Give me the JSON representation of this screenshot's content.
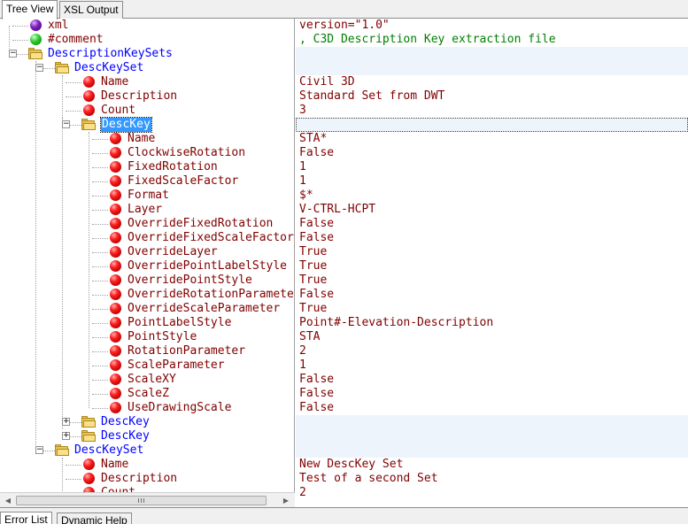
{
  "tabs": {
    "tree_view": "Tree View",
    "xsl_output": "XSL Output"
  },
  "bottom_tabs": {
    "error_list": "Error List",
    "dynamic_help": "Dynamic Help"
  },
  "tree": [
    {
      "label": "xml",
      "value": "version=\"1.0\"",
      "icon": "purple-ball",
      "expander": "none"
    },
    {
      "label": "#comment",
      "value": " , C3D Description Key extraction file",
      "icon": "green-ball",
      "expander": "none",
      "value_color": "green"
    },
    {
      "label": "DescriptionKeySets",
      "value": "",
      "icon": "folder",
      "expander": "minus"
    },
    {
      "label": "DescKeySet",
      "value": "",
      "icon": "folder",
      "expander": "minus"
    },
    {
      "label": "Name",
      "value": "Civil 3D",
      "icon": "red-ball",
      "expander": "none"
    },
    {
      "label": "Description",
      "value": "Standard Set from DWT",
      "icon": "red-ball",
      "expander": "none"
    },
    {
      "label": "Count",
      "value": "3",
      "icon": "red-ball",
      "expander": "none"
    },
    {
      "label": "DescKey",
      "value": "",
      "icon": "folder",
      "expander": "minus",
      "selected": true
    },
    {
      "label": "Name",
      "value": "STA*",
      "icon": "red-ball",
      "expander": "none"
    },
    {
      "label": "ClockwiseRotation",
      "value": "False",
      "icon": "red-ball",
      "expander": "none"
    },
    {
      "label": "FixedRotation",
      "value": "1",
      "icon": "red-ball",
      "expander": "none"
    },
    {
      "label": "FixedScaleFactor",
      "value": "1",
      "icon": "red-ball",
      "expander": "none"
    },
    {
      "label": "Format",
      "value": "$*",
      "icon": "red-ball",
      "expander": "none"
    },
    {
      "label": "Layer",
      "value": "V-CTRL-HCPT",
      "icon": "red-ball",
      "expander": "none"
    },
    {
      "label": "OverrideFixedRotation",
      "value": "False",
      "icon": "red-ball",
      "expander": "none"
    },
    {
      "label": "OverrideFixedScaleFactor",
      "value": "False",
      "icon": "red-ball",
      "expander": "none"
    },
    {
      "label": "OverrideLayer",
      "value": "True",
      "icon": "red-ball",
      "expander": "none"
    },
    {
      "label": "OverridePointLabelStyle",
      "value": "True",
      "icon": "red-ball",
      "expander": "none"
    },
    {
      "label": "OverridePointStyle",
      "value": "True",
      "icon": "red-ball",
      "expander": "none"
    },
    {
      "label": "OverrideRotationParameter",
      "value": "False",
      "icon": "red-ball",
      "expander": "none"
    },
    {
      "label": "OverrideScaleParameter",
      "value": "True",
      "icon": "red-ball",
      "expander": "none"
    },
    {
      "label": "PointLabelStyle",
      "value": "Point#-Elevation-Description",
      "icon": "red-ball",
      "expander": "none"
    },
    {
      "label": "PointStyle",
      "value": "STA",
      "icon": "red-ball",
      "expander": "none"
    },
    {
      "label": "RotationParameter",
      "value": "2",
      "icon": "red-ball",
      "expander": "none"
    },
    {
      "label": "ScaleParameter",
      "value": "1",
      "icon": "red-ball",
      "expander": "none"
    },
    {
      "label": "ScaleXY",
      "value": "False",
      "icon": "red-ball",
      "expander": "none"
    },
    {
      "label": "ScaleZ",
      "value": "False",
      "icon": "red-ball",
      "expander": "none"
    },
    {
      "label": "UseDrawingScale",
      "value": "False",
      "icon": "red-ball",
      "expander": "none"
    },
    {
      "label": "DescKey",
      "value": "",
      "icon": "folder",
      "expander": "plus"
    },
    {
      "label": "DescKey",
      "value": "",
      "icon": "folder",
      "expander": "plus"
    },
    {
      "label": "DescKeySet",
      "value": "",
      "icon": "folder",
      "expander": "minus"
    },
    {
      "label": "Name",
      "value": "New DescKey Set",
      "icon": "red-ball",
      "expander": "none"
    },
    {
      "label": "Description",
      "value": "Test of a second Set",
      "icon": "red-ball",
      "expander": "none"
    },
    {
      "label": "Count",
      "value": "2",
      "icon": "red-ball",
      "expander": "none"
    }
  ]
}
